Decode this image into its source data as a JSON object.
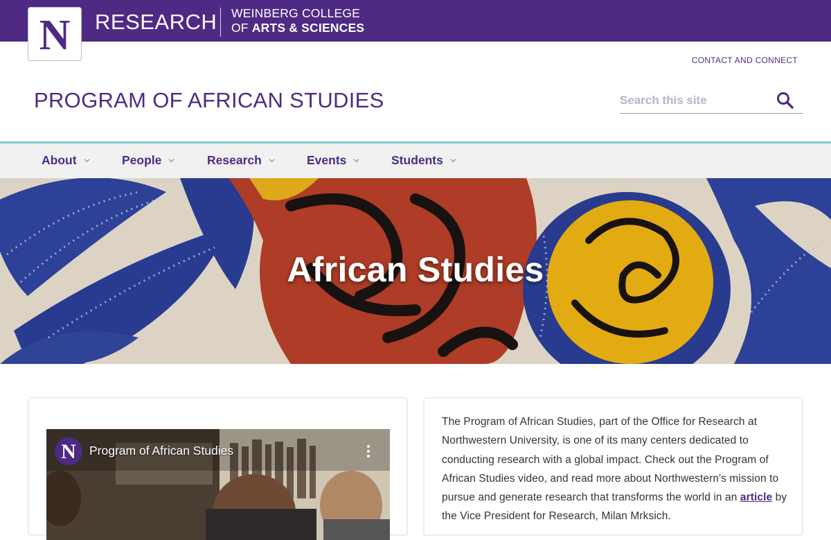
{
  "brand": {
    "logo_letter": "N",
    "research": "RESEARCH",
    "college_line1": "WEINBERG COLLEGE",
    "college_of": "OF",
    "college_arts": "ARTS & SCIENCES"
  },
  "header": {
    "contact": "CONTACT AND CONNECT",
    "site_title": "PROGRAM OF AFRICAN STUDIES",
    "search_placeholder": "Search this site",
    "search_icon": "search-icon"
  },
  "nav": {
    "items": [
      {
        "label": "About"
      },
      {
        "label": "People"
      },
      {
        "label": "Research"
      },
      {
        "label": "Events"
      },
      {
        "label": "Students"
      }
    ]
  },
  "hero": {
    "title": "African Studies"
  },
  "video": {
    "channel_letter": "N",
    "title": "Program of African Studies"
  },
  "intro": {
    "text_before": "The Program of African Studies, part of the Office for Research at Northwestern University, is one of its many centers dedicated to conducting research with a global impact. Check out the Program of African Studies video, and read more about Northwestern's mission to pursue and generate research that transforms the world in an ",
    "link": "article",
    "text_after": " by the Vice President for Research, Milan Mrksich."
  },
  "colors": {
    "purple": "#4e2a84",
    "teal": "#7fcecd",
    "nav_bg": "#f1f1f1"
  }
}
